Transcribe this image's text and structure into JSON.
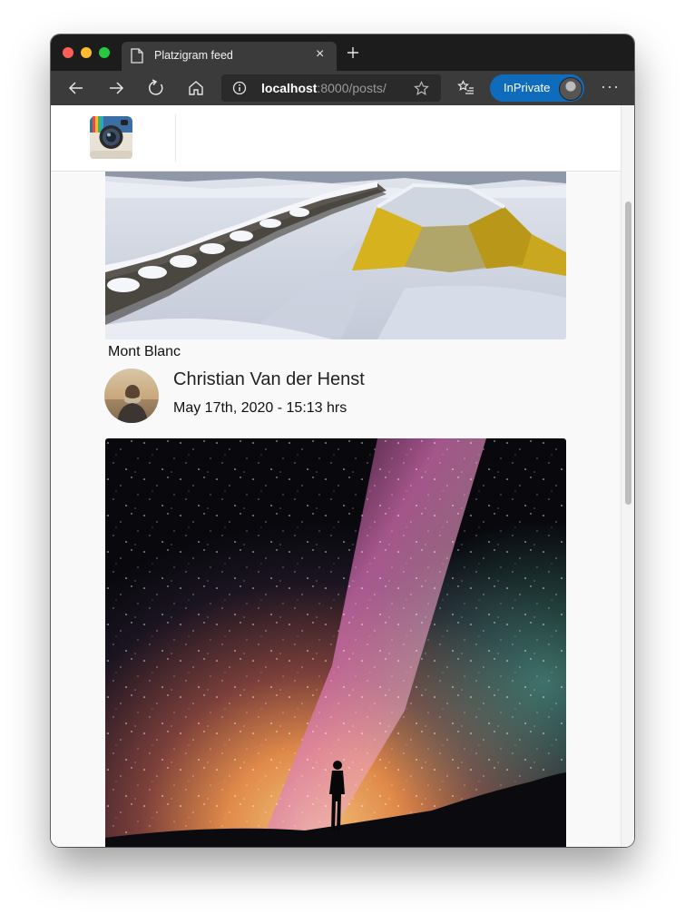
{
  "browser": {
    "tab_title": "Platzigram feed",
    "tab_close_glyph": "×",
    "url_host": "localhost",
    "url_rest": ":8000/posts/",
    "inprivate_label": "InPrivate",
    "more_glyph": "···",
    "icons": [
      "document-icon",
      "close-icon",
      "plus-icon",
      "back-arrow-icon",
      "forward-arrow-icon",
      "refresh-icon",
      "home-icon",
      "info-icon",
      "star-icon",
      "favorites-icon",
      "avatar-icon",
      "more-icon"
    ]
  },
  "app": {
    "logo_icon": "camera-logo-icon"
  },
  "posts": [
    {
      "caption": "Mont Blanc",
      "author": "Christian Van der Henst",
      "timestamp": "May 17th, 2020 - 15:13 hrs"
    }
  ],
  "colors": {
    "accent": "#0f6cbd",
    "tabbar": "#1c1c1c",
    "toolbar": "#3b3b3b"
  }
}
